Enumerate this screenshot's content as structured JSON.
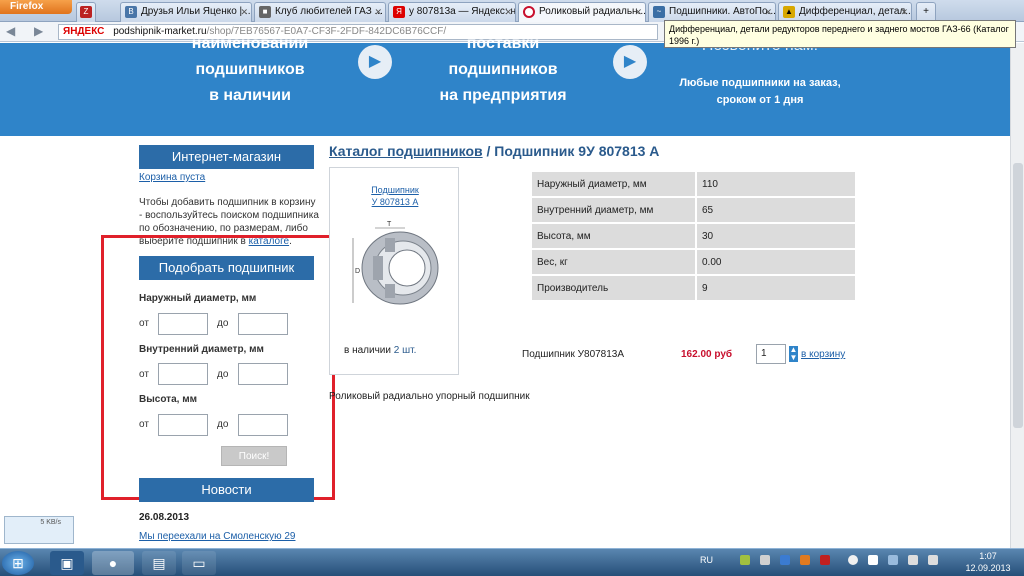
{
  "browser": {
    "menu_label": "Firefox",
    "tabs": [
      {
        "label": "Друзья Ильи Яценко | ...",
        "icon": "vk-icon",
        "color": "#4a76a8"
      },
      {
        "label": "Клуб любителей ГАЗ ...",
        "icon": "forum-icon",
        "color": "#666666"
      },
      {
        "label": "у 807813а — Яндекс: н...",
        "icon": "yandex-icon",
        "color": "#d00000"
      },
      {
        "label": "Роликовый радиальн...",
        "icon": "site-icon",
        "color": "#c8102e",
        "active": true
      },
      {
        "label": "Подшипники. АвтоПо...",
        "icon": "page-icon",
        "color": "#3a6ea5"
      },
      {
        "label": "Дифференциал, детал...",
        "icon": "warning-icon",
        "color": "#d8a800"
      }
    ],
    "address": {
      "yandex_label": "ЯНДЕКС",
      "host": "podshipnik-market.ru",
      "path": "/shop/7EB76567-E0A7-CF3F-2FDF-842DC6B76CCF/"
    },
    "tooltip": "Дифференциал, детали редукторов переднего и заднего мостов ГАЗ-66 (Каталог 1996 г.)"
  },
  "banner": {
    "col1": [
      "наименований",
      "подшипников",
      "в наличии"
    ],
    "col2": [
      "поставки",
      "подшипников",
      "на предприятия"
    ],
    "col3_head": "Позвоните нам!",
    "col3_sub": [
      "Любые подшипники на заказ,",
      "сроком от 1 дня"
    ]
  },
  "sidebar": {
    "shop_title": "Интернет-магазин",
    "cart_empty": "Корзина пуста",
    "cart_help_prefix": "Чтобы добавить подшипник в корзину - воспользуйтесь поиском подшипника по обозначению, по размерам, либо выберите подшипник в",
    "cart_help_link": "каталоге",
    "cart_help_suffix": ".",
    "filter_title": "Подобрать подшипник",
    "outer_label": "Наружный диаметр, мм",
    "inner_label": "Внутренний диаметр, мм",
    "height_label": "Высота, мм",
    "from": "от",
    "to": "до",
    "search_button": "Поиск!",
    "news_title": "Новости",
    "news_date": "26.08.2013",
    "news_link": "Мы переехали на Смоленскую 29"
  },
  "product": {
    "breadcrumb_link": "Каталог подшипников",
    "breadcrumb_sep": " / ",
    "breadcrumb_current": "Подшипник 9У 807813 А",
    "card_title_1": "Подшипник",
    "card_title_2": "У 807813 А",
    "stock_prefix": "в наличии",
    "stock_count": "2 шт.",
    "specs": [
      {
        "key": "Наружный диаметр, мм",
        "value": "110"
      },
      {
        "key": "Внутренний диаметр, мм",
        "value": "65"
      },
      {
        "key": "Высота, мм",
        "value": "30"
      },
      {
        "key": "Вес, кг",
        "value": "0.00"
      },
      {
        "key": "Производитель",
        "value": "9"
      }
    ],
    "buy_name": "Подшипник У807813А",
    "price": "162.00 руб",
    "qty": "1",
    "add_to_cart": "в корзину",
    "description": "Роликовый радиально упорный подшипник",
    "drawing_labels": {
      "t": "T",
      "d_outer": "D",
      "d_inner": "d"
    }
  },
  "widget": {
    "speed": "5 KB/s"
  },
  "taskbar": {
    "lang": "RU",
    "time": "1:07",
    "date": "12.09.2013"
  },
  "colors": {
    "banner": "#2f84c9",
    "sidebar_head": "#2c6ca8",
    "price": "#c8102e",
    "highlight_frame": "#e0202a"
  }
}
